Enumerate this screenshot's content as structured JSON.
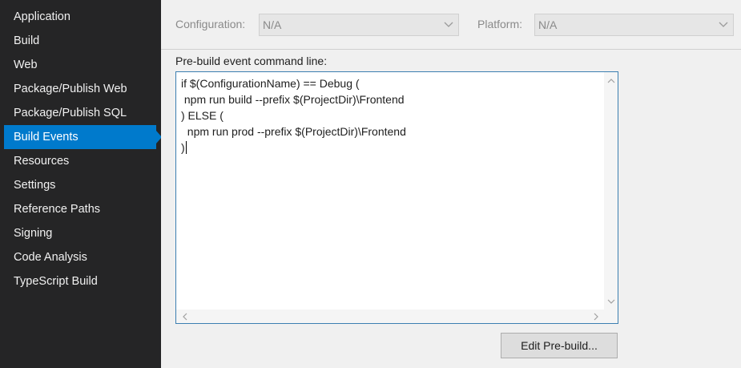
{
  "sidebar": {
    "items": [
      {
        "label": "Application",
        "active": false
      },
      {
        "label": "Build",
        "active": false
      },
      {
        "label": "Web",
        "active": false
      },
      {
        "label": "Package/Publish Web",
        "active": false
      },
      {
        "label": "Package/Publish SQL",
        "active": false
      },
      {
        "label": "Build Events",
        "active": true
      },
      {
        "label": "Resources",
        "active": false
      },
      {
        "label": "Settings",
        "active": false
      },
      {
        "label": "Reference Paths",
        "active": false
      },
      {
        "label": "Signing",
        "active": false
      },
      {
        "label": "Code Analysis",
        "active": false
      },
      {
        "label": "TypeScript Build",
        "active": false
      }
    ]
  },
  "topbar": {
    "configuration_label": "Configuration:",
    "configuration_value": "N/A",
    "platform_label": "Platform:",
    "platform_value": "N/A"
  },
  "prebuild": {
    "label": "Pre-build event command line:",
    "lines": [
      "if $(ConfigurationName) == Debug (",
      " npm run build --prefix $(ProjectDir)\\Frontend",
      ") ELSE (",
      "  npm run prod --prefix $(ProjectDir)\\Frontend",
      ")"
    ],
    "edit_button_label": "Edit Pre-build..."
  },
  "colors": {
    "accent": "#007acc",
    "sidebar_bg": "#252526",
    "panel_bg": "#f0f0f0"
  }
}
